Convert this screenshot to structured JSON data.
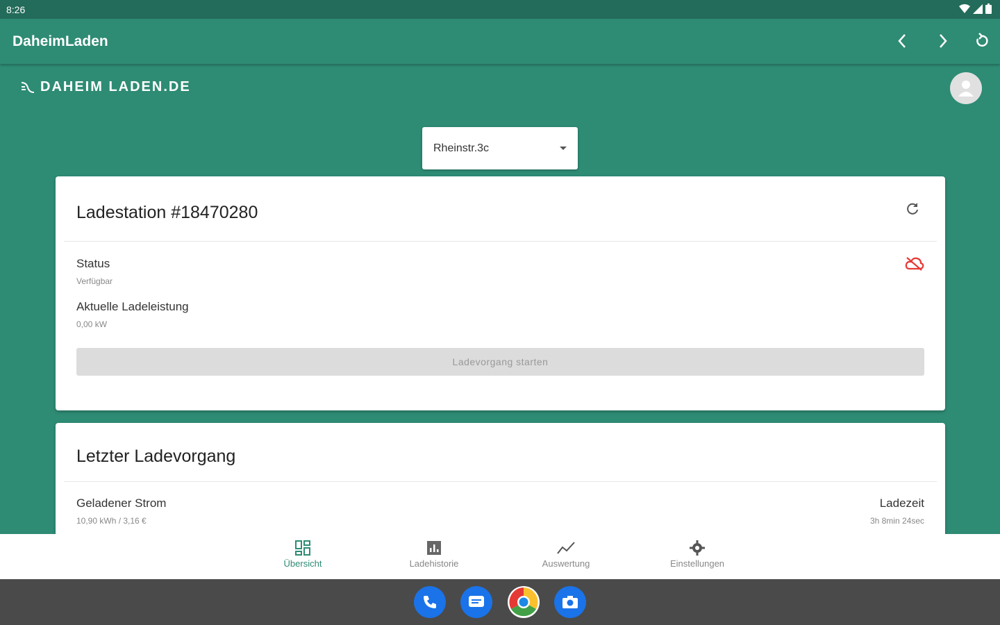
{
  "statusbar": {
    "time": "8:26"
  },
  "appbar": {
    "title": "DaheimLaden"
  },
  "brand": {
    "text": "DAHEIM LADEN.DE"
  },
  "location_select": {
    "value": "Rheinstr.3c"
  },
  "station_card": {
    "title": "Ladestation #18470280",
    "status_label": "Status",
    "status_value": "Verfügbar",
    "power_label": "Aktuelle Ladeleistung",
    "power_value": "0,00 kW",
    "start_button": "Ladevorgang starten"
  },
  "last_card": {
    "title": "Letzter Ladevorgang",
    "energy_label": "Geladener Strom",
    "energy_value": "10,90 kWh / 3,16 €",
    "time_label": "Ladezeit",
    "time_value": "3h 8min 24sec"
  },
  "bottom_nav": [
    {
      "label": "Übersicht",
      "icon": "dashboard-icon",
      "active": true
    },
    {
      "label": "Ladehistorie",
      "icon": "bar-chart-icon",
      "active": false
    },
    {
      "label": "Auswertung",
      "icon": "trend-icon",
      "active": false
    },
    {
      "label": "Einstellungen",
      "icon": "gear-icon",
      "active": false
    }
  ],
  "dock": [
    "phone-icon",
    "messages-icon",
    "chrome-icon",
    "camera-icon"
  ],
  "colors": {
    "primary": "#2e8b74",
    "statusbar": "#236b5a",
    "error": "#e53935"
  }
}
